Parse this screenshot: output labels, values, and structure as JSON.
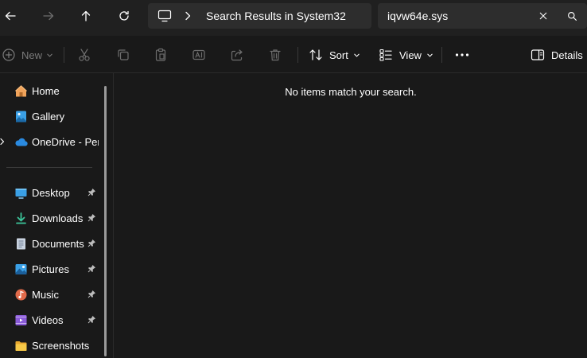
{
  "address_bar": {
    "breadcrumb": "Search Results in System32"
  },
  "search": {
    "query": "iqvw64e.sys"
  },
  "toolbar": {
    "new_label": "New",
    "sort_label": "Sort",
    "view_label": "View",
    "details_label": "Details"
  },
  "sidebar": {
    "items": [
      {
        "label": "Home"
      },
      {
        "label": "Gallery"
      },
      {
        "label": "OneDrive - Personal"
      },
      {
        "label": "Desktop"
      },
      {
        "label": "Downloads"
      },
      {
        "label": "Documents"
      },
      {
        "label": "Pictures"
      },
      {
        "label": "Music"
      },
      {
        "label": "Videos"
      },
      {
        "label": "Screenshots"
      }
    ]
  },
  "content": {
    "empty_message": "No items match your search."
  },
  "colors": {
    "accent": "#4cc2ff",
    "background": "#191919",
    "chrome": "#202020",
    "field": "#2d2d2d"
  }
}
